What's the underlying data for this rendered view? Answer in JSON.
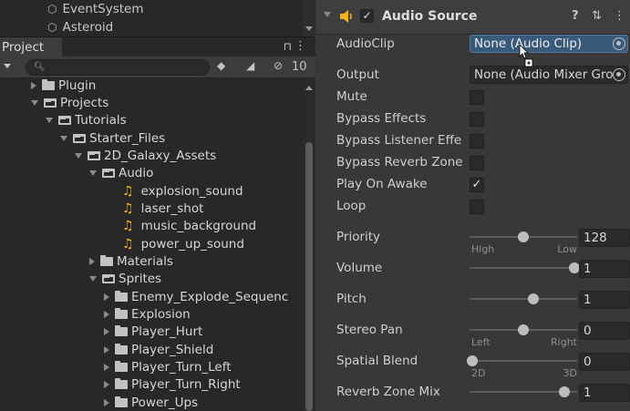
{
  "hierarchy": {
    "items": [
      {
        "label": "EventSystem",
        "icon": "gameobject-icon"
      },
      {
        "label": "Asteroid",
        "icon": "gameobject-icon"
      }
    ]
  },
  "project": {
    "tab_label": "Project",
    "lock_icon": "lock-icon",
    "menu_icon": "kebab-menu-icon",
    "search_placeholder": "",
    "hidden_count": "10",
    "tree": [
      {
        "label": "Plugin",
        "depth": 0,
        "expanded": false,
        "kind": "folder"
      },
      {
        "label": "Projects",
        "depth": 0,
        "expanded": true,
        "kind": "folder"
      },
      {
        "label": "Tutorials",
        "depth": 1,
        "expanded": true,
        "kind": "folder"
      },
      {
        "label": "Starter_Files",
        "depth": 2,
        "expanded": true,
        "kind": "folder"
      },
      {
        "label": "2D_Galaxy_Assets",
        "depth": 3,
        "expanded": true,
        "kind": "folder"
      },
      {
        "label": "Audio",
        "depth": 4,
        "expanded": true,
        "kind": "folder"
      },
      {
        "label": "explosion_sound",
        "depth": 5,
        "kind": "audio"
      },
      {
        "label": "laser_shot",
        "depth": 5,
        "kind": "audio"
      },
      {
        "label": "music_background",
        "depth": 5,
        "kind": "audio"
      },
      {
        "label": "power_up_sound",
        "depth": 5,
        "kind": "audio"
      },
      {
        "label": "Materials",
        "depth": 4,
        "expanded": false,
        "kind": "folder"
      },
      {
        "label": "Sprites",
        "depth": 4,
        "expanded": true,
        "kind": "folder"
      },
      {
        "label": "Enemy_Explode_Sequenc",
        "depth": 5,
        "expanded": false,
        "kind": "folder"
      },
      {
        "label": "Explosion",
        "depth": 5,
        "expanded": false,
        "kind": "folder"
      },
      {
        "label": "Player_Hurt",
        "depth": 5,
        "expanded": false,
        "kind": "folder"
      },
      {
        "label": "Player_Shield",
        "depth": 5,
        "expanded": false,
        "kind": "folder"
      },
      {
        "label": "Player_Turn_Left",
        "depth": 5,
        "expanded": false,
        "kind": "folder"
      },
      {
        "label": "Player_Turn_Right",
        "depth": 5,
        "expanded": false,
        "kind": "folder"
      },
      {
        "label": "Power_Ups",
        "depth": 5,
        "expanded": false,
        "kind": "folder"
      }
    ]
  },
  "inspector": {
    "component_title": "Audio Source",
    "enabled_mark": "✓",
    "help_icon": "help-icon",
    "preset_icon": "preset-icon",
    "menu_icon": "kebab-menu-icon",
    "audio_clip": {
      "label": "AudioClip",
      "value": "None (Audio Clip)"
    },
    "output": {
      "label": "Output",
      "value": "None (Audio Mixer Gro"
    },
    "toggles": [
      {
        "label": "Mute",
        "checked": false
      },
      {
        "label": "Bypass Effects",
        "checked": false
      },
      {
        "label": "Bypass Listener Effe",
        "checked": false
      },
      {
        "label": "Bypass Reverb Zone",
        "checked": false
      },
      {
        "label": "Play On Awake",
        "checked": true
      },
      {
        "label": "Loop",
        "checked": false
      }
    ],
    "sliders": [
      {
        "label": "Priority",
        "value": "128",
        "fraction": 0.5,
        "left_caption": "High",
        "right_caption": "Low"
      },
      {
        "label": "Volume",
        "value": "1",
        "fraction": 1.0,
        "left_caption": "",
        "right_caption": ""
      },
      {
        "label": "Pitch",
        "value": "1",
        "fraction": 0.6,
        "left_caption": "",
        "right_caption": ""
      },
      {
        "label": "Stereo Pan",
        "value": "0",
        "fraction": 0.5,
        "left_caption": "Left",
        "right_caption": "Right"
      },
      {
        "label": "Spatial Blend",
        "value": "0",
        "fraction": 0.0,
        "left_caption": "2D",
        "right_caption": "3D"
      },
      {
        "label": "Reverb Zone Mix",
        "value": "1",
        "fraction": 0.9,
        "left_caption": "",
        "right_caption": ""
      }
    ]
  },
  "colors": {
    "audio_icon": "#f2b31b",
    "selected_field": "#3a5a7a"
  }
}
